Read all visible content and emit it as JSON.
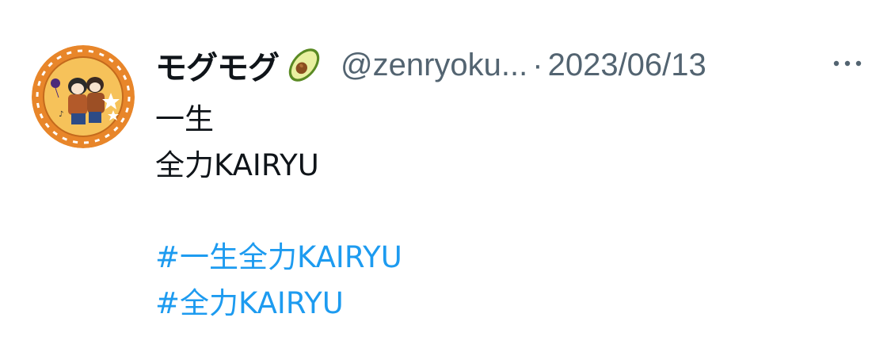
{
  "tweet": {
    "display_name": "モグモグ",
    "name_emoji": "avocado-emoji",
    "handle": "@zenryoku...",
    "separator": "·",
    "timestamp": "2023/06/13",
    "text_lines": [
      "一生",
      "全力KAIRYU"
    ],
    "hashtags": [
      "#一生全力KAIRYU",
      "#全力KAIRYU"
    ]
  },
  "icons": {
    "more": "more-horizontal-icon",
    "avatar": "profile-avatar"
  },
  "colors": {
    "text": "#0f1419",
    "secondary": "#536471",
    "link": "#1d9bf0",
    "avatar_ring": "#e87d23"
  }
}
